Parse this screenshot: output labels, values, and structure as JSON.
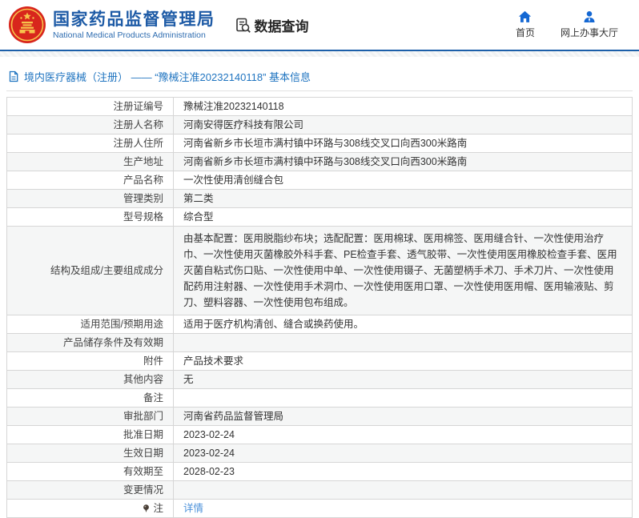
{
  "header": {
    "org_name_cn": "国家药品监督管理局",
    "org_name_en": "National Medical Products Administration",
    "section_title": "数据查询",
    "nav": [
      {
        "label": "首页"
      },
      {
        "label": "网上办事大厅"
      }
    ]
  },
  "breadcrumb": {
    "text": "境内医疗器械（注册） —— “豫械注准20232140118” 基本信息"
  },
  "table": {
    "rows": [
      {
        "label": "注册证编号",
        "value": "豫械注准20232140118"
      },
      {
        "label": "注册人名称",
        "value": "河南安得医疗科技有限公司"
      },
      {
        "label": "注册人住所",
        "value": "河南省新乡市长垣市满村镇中环路与308线交叉口向西300米路南"
      },
      {
        "label": "生产地址",
        "value": "河南省新乡市长垣市满村镇中环路与308线交叉口向西300米路南"
      },
      {
        "label": "产品名称",
        "value": "一次性使用清创缝合包"
      },
      {
        "label": "管理类别",
        "value": "第二类"
      },
      {
        "label": "型号规格",
        "value": "综合型"
      },
      {
        "label": "结构及组成/主要组成成分",
        "value": "由基本配置：医用脱脂纱布块；选配配置：医用棉球、医用棉签、医用缝合针、一次性使用治疗巾、一次性使用灭菌橡胶外科手套、PE检查手套、透气胶带、一次性使用医用橡胶检查手套、医用灭菌自粘式伤口贴、一次性使用中单、一次性使用镊子、无菌塑柄手术刀、手术刀片、一次性使用配药用注射器、一次性使用手术洞巾、一次性使用医用口罩、一次性使用医用帽、医用输液贴、剪刀、塑料容器、一次性使用包布组成。",
        "multiline": true
      },
      {
        "label": "适用范围/预期用途",
        "value": "适用于医疗机构清创、缝合或换药使用。"
      },
      {
        "label": "产品储存条件及有效期",
        "value": ""
      },
      {
        "label": "附件",
        "value": "产品技术要求"
      },
      {
        "label": "其他内容",
        "value": "无"
      },
      {
        "label": "备注",
        "value": ""
      },
      {
        "label": "审批部门",
        "value": "河南省药品监督管理局"
      },
      {
        "label": "批准日期",
        "value": "2023-02-24"
      },
      {
        "label": "生效日期",
        "value": "2023-02-24"
      },
      {
        "label": "有效期至",
        "value": "2028-02-23"
      },
      {
        "label": "变更情况",
        "value": ""
      },
      {
        "label": "注",
        "value": "详情",
        "link": true,
        "note_icon": true
      }
    ]
  },
  "colors": {
    "brand_blue": "#1e5ba6",
    "icon_blue": "#1568d3",
    "breadcrumb_blue": "#1f74c0",
    "link_blue": "#4a90d9",
    "row_alt_bg": "#f5f6f6",
    "border_gray": "#d6d6d6",
    "emblem_red": "#d8261c",
    "emblem_gold": "#f7c34c"
  }
}
